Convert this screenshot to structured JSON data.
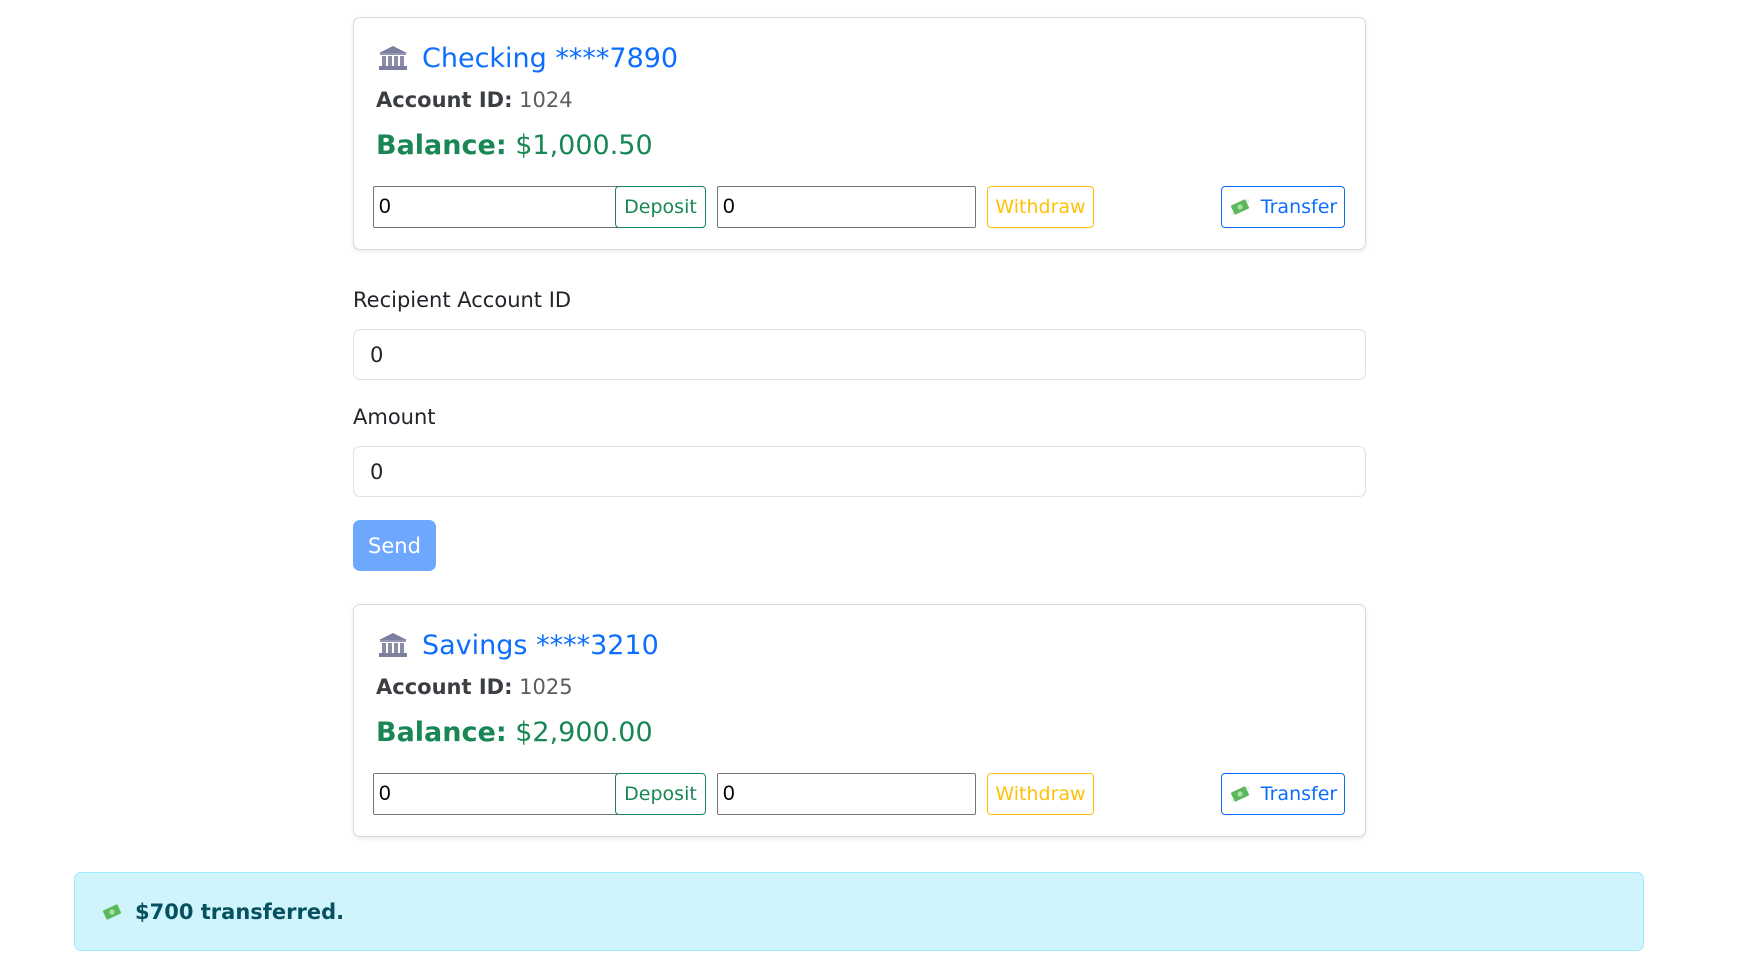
{
  "accounts": [
    {
      "title": "Checking ****7890",
      "account_id_label": "Account ID:",
      "account_id": "1024",
      "balance_label": "Balance:",
      "balance": "$1,000.50",
      "deposit_amount": "0",
      "withdraw_amount": "0",
      "deposit_label": "Deposit",
      "withdraw_label": "Withdraw",
      "transfer_label": "Transfer"
    },
    {
      "title": "Savings ****3210",
      "account_id_label": "Account ID:",
      "account_id": "1025",
      "balance_label": "Balance:",
      "balance": "$2,900.00",
      "deposit_amount": "0",
      "withdraw_amount": "0",
      "deposit_label": "Deposit",
      "withdraw_label": "Withdraw",
      "transfer_label": "Transfer"
    }
  ],
  "transfer_form": {
    "recipient_label": "Recipient Account ID",
    "recipient_value": "0",
    "amount_label": "Amount",
    "amount_value": "0",
    "send_label": "Send"
  },
  "alert": {
    "message": "$700 transferred."
  },
  "icons": {
    "bank": "bank-icon",
    "money": "money-with-wings-icon"
  },
  "colors": {
    "primary": "#0d6efd",
    "success": "#198754",
    "warning": "#ffc107",
    "info_bg": "#cff4fc",
    "info_text": "#055160"
  }
}
